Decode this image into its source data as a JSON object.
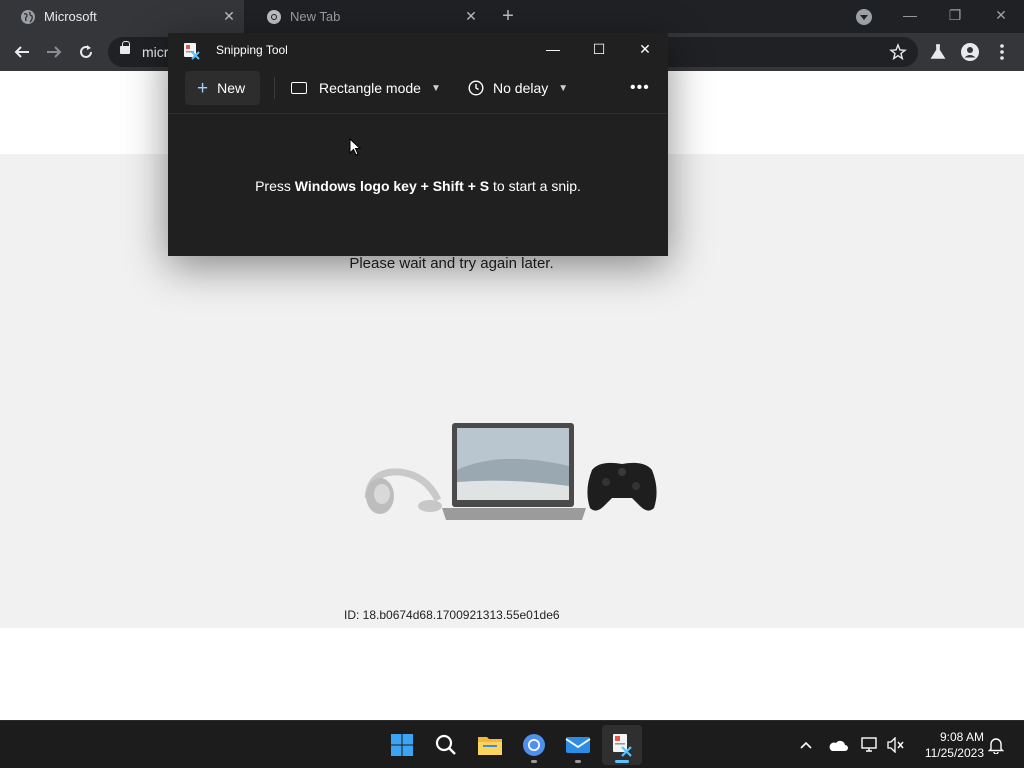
{
  "browser": {
    "tabs": [
      {
        "title": "Microsoft",
        "active": true
      },
      {
        "title": "New Tab",
        "active": false
      }
    ],
    "url_text": "micr"
  },
  "page": {
    "message": "Please wait and try again later.",
    "reference_id": "ID: 18.b0674d68.1700921313.55e01de6"
  },
  "snipping_tool": {
    "title": "Snipping Tool",
    "new_label": "New",
    "mode_label": "Rectangle mode",
    "delay_label": "No delay",
    "more_label": "•••",
    "hint_prefix": "Press ",
    "hint_keys": "Windows logo key + Shift + S",
    "hint_suffix": " to start a snip."
  },
  "taskbar": {
    "time": "9:08 AM",
    "date": "11/25/2023"
  },
  "colors": {
    "accent": "#5cc2ff",
    "chrome_dark": "#202124",
    "snip_bg": "#202020"
  }
}
